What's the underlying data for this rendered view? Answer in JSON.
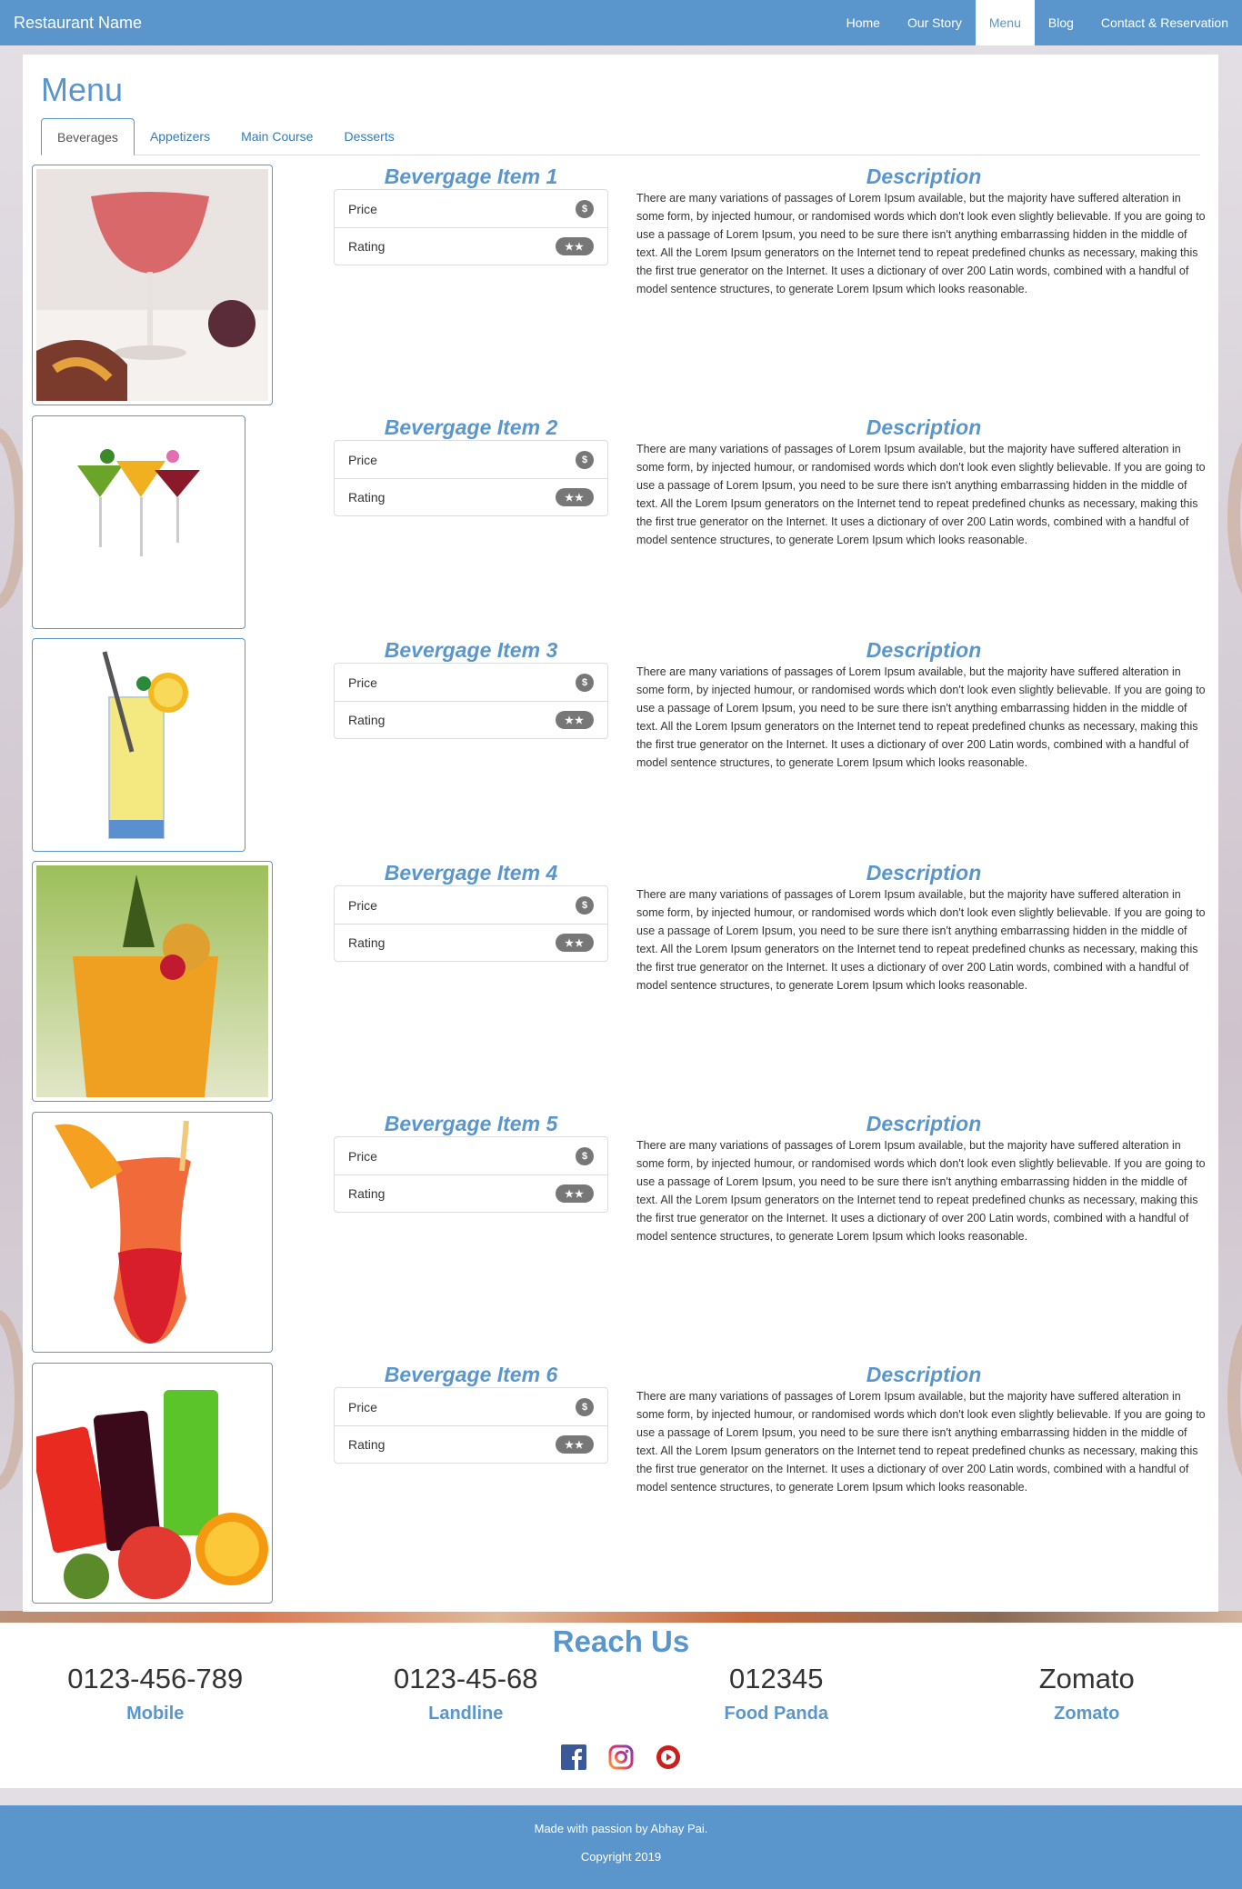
{
  "brand": "Restaurant Name",
  "nav": [
    "Home",
    "Our Story",
    "Menu",
    "Blog",
    "Contact & Reservation"
  ],
  "nav_active": "Menu",
  "page_title": "Menu",
  "tabs": [
    "Beverages",
    "Appetizers",
    "Main Course",
    "Desserts"
  ],
  "tab_active": "Beverages",
  "item_labels": {
    "price": "Price",
    "rating": "Rating",
    "price_badge": "$",
    "rating_badge": "★★"
  },
  "description_title": "Description",
  "description_text": "There are many variations of passages of Lorem Ipsum available, but the majority have suffered alteration in some form, by injected humour, or randomised words which don't look even slightly believable. If you are going to use a passage of Lorem Ipsum, you need to be sure there isn't anything embarrassing hidden in the middle of text. All the Lorem Ipsum generators on the Internet tend to repeat predefined chunks as necessary, making this the first true generator on the Internet. It uses a dictionary of over 200 Latin words, combined with a handful of model sentence structures, to generate Lorem Ipsum which looks reasonable.",
  "items": [
    {
      "name": "Bevergage Item 1",
      "image": "pink-cocktail-coupe"
    },
    {
      "name": "Bevergage Item 2",
      "image": "three-martini-glasses"
    },
    {
      "name": "Bevergage Item 3",
      "image": "lemonade-highball"
    },
    {
      "name": "Bevergage Item 4",
      "image": "orange-punch-pineapple"
    },
    {
      "name": "Bevergage Item 5",
      "image": "hurricane-cocktail-orange"
    },
    {
      "name": "Bevergage Item 6",
      "image": "juice-glasses-fruits"
    }
  ],
  "reach": {
    "title": "Reach Us",
    "contacts": [
      {
        "value": "0123-456-789",
        "label": "Mobile"
      },
      {
        "value": "0123-45-68",
        "label": "Landline"
      },
      {
        "value": "012345",
        "label": "Food Panda"
      },
      {
        "value": "Zomato",
        "label": "Zomato"
      }
    ],
    "social": [
      "facebook-icon",
      "instagram-icon",
      "youtube-icon"
    ]
  },
  "footer": {
    "line1": "Made with passion by Abhay Pai.",
    "line2": "Copyright 2019"
  },
  "colors": {
    "primary": "#5a96cc",
    "badge": "#777777"
  }
}
